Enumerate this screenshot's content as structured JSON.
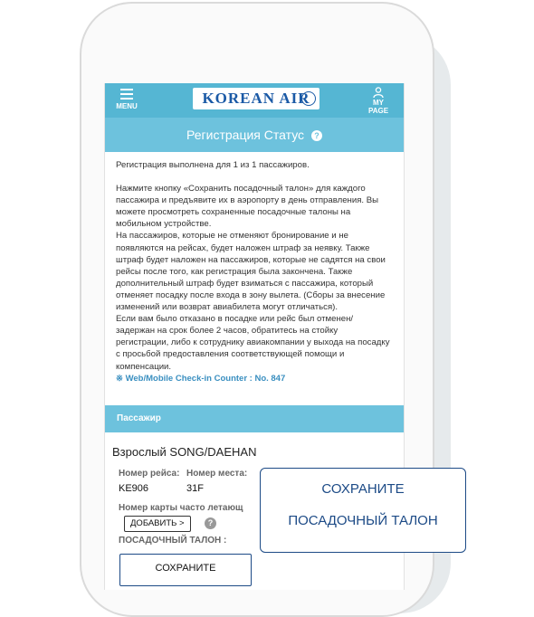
{
  "header": {
    "menu_label": "MENU",
    "logo_text": "KOREAN AIR",
    "mypage_label": "MY PAGE"
  },
  "title": {
    "text": "Регистрация Статус",
    "help": "?"
  },
  "content": {
    "p1": "Регистрация выполнена для 1 из 1 пассажиров.",
    "p2": "Нажмите кнопку «Сохранить посадочный талон» для каждого пассажира и предъявите их в аэропорту в день отправления. Вы можете просмотреть сохраненные посадочные талоны на мобильном устройстве.",
    "p3": "На пассажиров, которые не отменяют бронирование и не появляются на рейсах, будет наложен штраф за неявку. Также штраф будет наложен на пассажиров, которые не садятся на свои рейсы после того, как регистрация была закончена. Также дополнительный штраф будет взиматься с пассажира, который отменяет посадку после входа в зону вылета. (Сборы за внесение изменений или возврат авиабилета могут отличаться).",
    "p4": "Если вам было отказано в посадке или рейс был отменен/ задержан на срок более 2 часов, обратитесь на стойку регистрации, либо к сотруднику авиакомпании у выхода на посадку с просьбой предоставления соответствующей помощи и компенсации.",
    "counter": "※ Web/Mobile Check-in Counter : No. 847"
  },
  "passenger": {
    "section_title": "Пассажир",
    "name": "Взрослый SONG/DAEHAN",
    "flight_label": "Номер рейса:",
    "seat_label": "Номер места:",
    "flight_value": "KE906",
    "seat_value": "31F",
    "ffp_label": "Номер карты часто летающ",
    "add_button": "ДОБАВИТЬ >",
    "help": "?",
    "boarding_label": "ПОСАДОЧНЫЙ ТАЛОН :",
    "save_button": "СОХРАНИТЕ"
  },
  "popup": {
    "line1": "СОХРАНИТЕ",
    "line2": "ПОСАДОЧНЫЙ ТАЛОН"
  },
  "colors": {
    "bar": "#55b6d3",
    "title_bar": "#6dc2dd",
    "navy": "#1c4a86"
  }
}
